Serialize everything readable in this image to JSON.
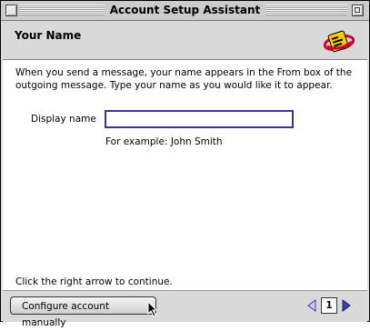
{
  "window": {
    "title": "Account Setup Assistant"
  },
  "header": {
    "title": "Your Name",
    "icon": "mail-envelope-logo-icon"
  },
  "content": {
    "intro": "When you send a message, your name appears in the From box of the outgoing message. Type your name as you would like it to appear.",
    "display_name_label": "Display name",
    "display_name_value": "",
    "example": "For example: John Smith",
    "continue_hint": "Click the right arrow to continue."
  },
  "footer": {
    "manual_button": "Configure account manually",
    "page_number": "1",
    "back_icon": "left-arrow-icon",
    "forward_icon": "right-arrow-icon"
  },
  "colors": {
    "input_focus": "#34369a",
    "nav_arrow": "#3b3fb0",
    "logo_yellow": "#ffcc00",
    "logo_red": "#cc0033"
  }
}
